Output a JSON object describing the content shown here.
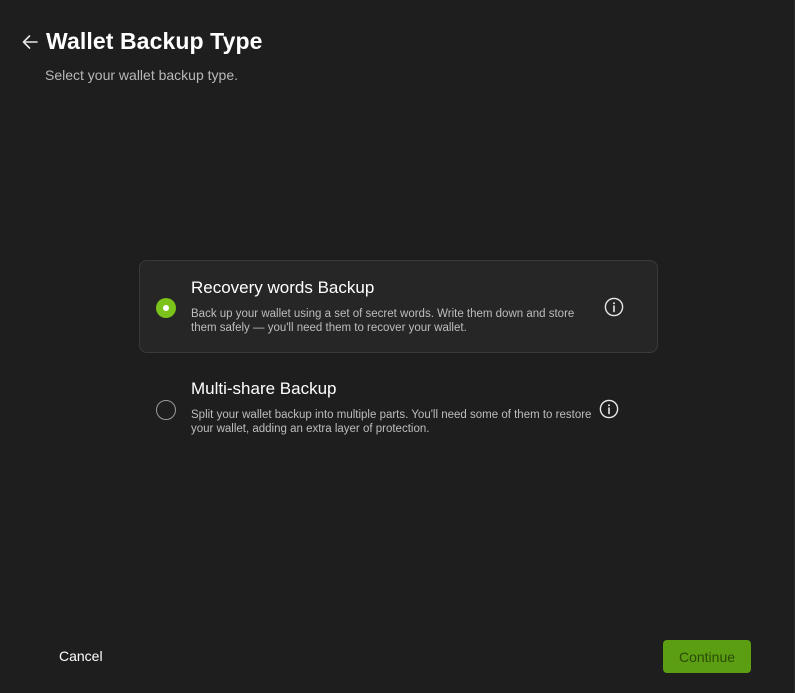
{
  "header": {
    "title": "Wallet Backup Type",
    "subtitle": "Select your wallet backup type.",
    "back_icon": "arrow-left-icon"
  },
  "options": [
    {
      "title": "Recovery words Backup",
      "description": "Back up your wallet using a set of secret words. Write them down and store them safely — you'll need them to recover your wallet.",
      "selected": true,
      "info_icon": "info-icon"
    },
    {
      "title": "Multi-share Backup",
      "description": "Split your wallet backup into multiple parts. You'll need some of them to restore your wallet, adding an extra layer of protection.",
      "selected": false,
      "info_icon": "info-icon"
    }
  ],
  "footer": {
    "cancel_label": "Cancel",
    "continue_label": "Continue"
  },
  "colors": {
    "background": "#1e1e1e",
    "accent": "#7bc21b",
    "continue_bg": "#5b9e12"
  }
}
